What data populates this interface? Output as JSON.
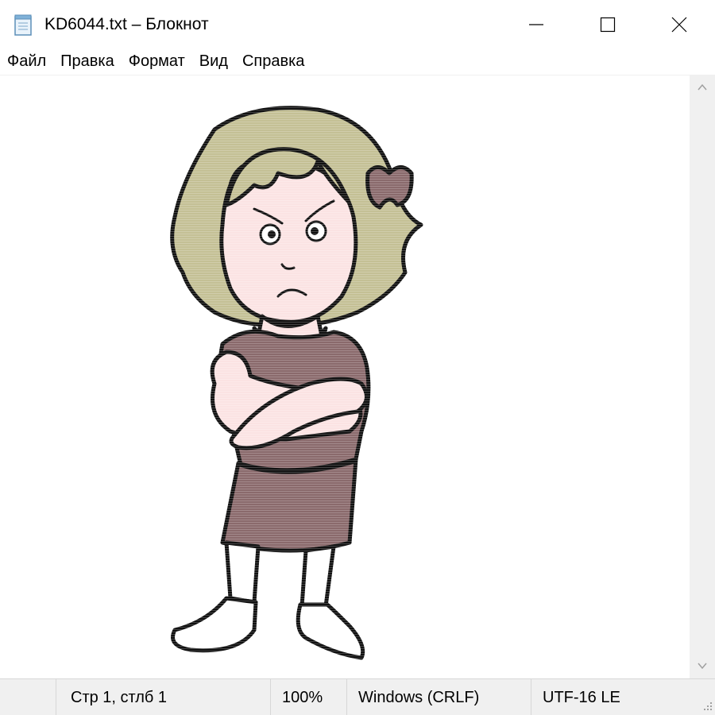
{
  "window": {
    "title": "KD6044.txt – Блокнот",
    "icon": "notepad-icon",
    "controls": [
      "minimize-icon",
      "maximize-icon",
      "close-icon"
    ]
  },
  "menu": {
    "items": [
      "Файл",
      "Правка",
      "Формат",
      "Вид",
      "Справка"
    ]
  },
  "editor": {
    "content_description_icon": "ascii-art-girl"
  },
  "status": {
    "position": "Стр 1, стлб 1",
    "zoom": "100%",
    "line_endings": "Windows (CRLF)",
    "encoding": "UTF-16 LE"
  },
  "colors": {
    "hair": "#c4c095",
    "skin": "#fbe3e3",
    "dress": "#8a6a6c",
    "outline": "#111111",
    "scrollbar": "#f0f0f0",
    "statusbar": "#f0f0f0"
  }
}
